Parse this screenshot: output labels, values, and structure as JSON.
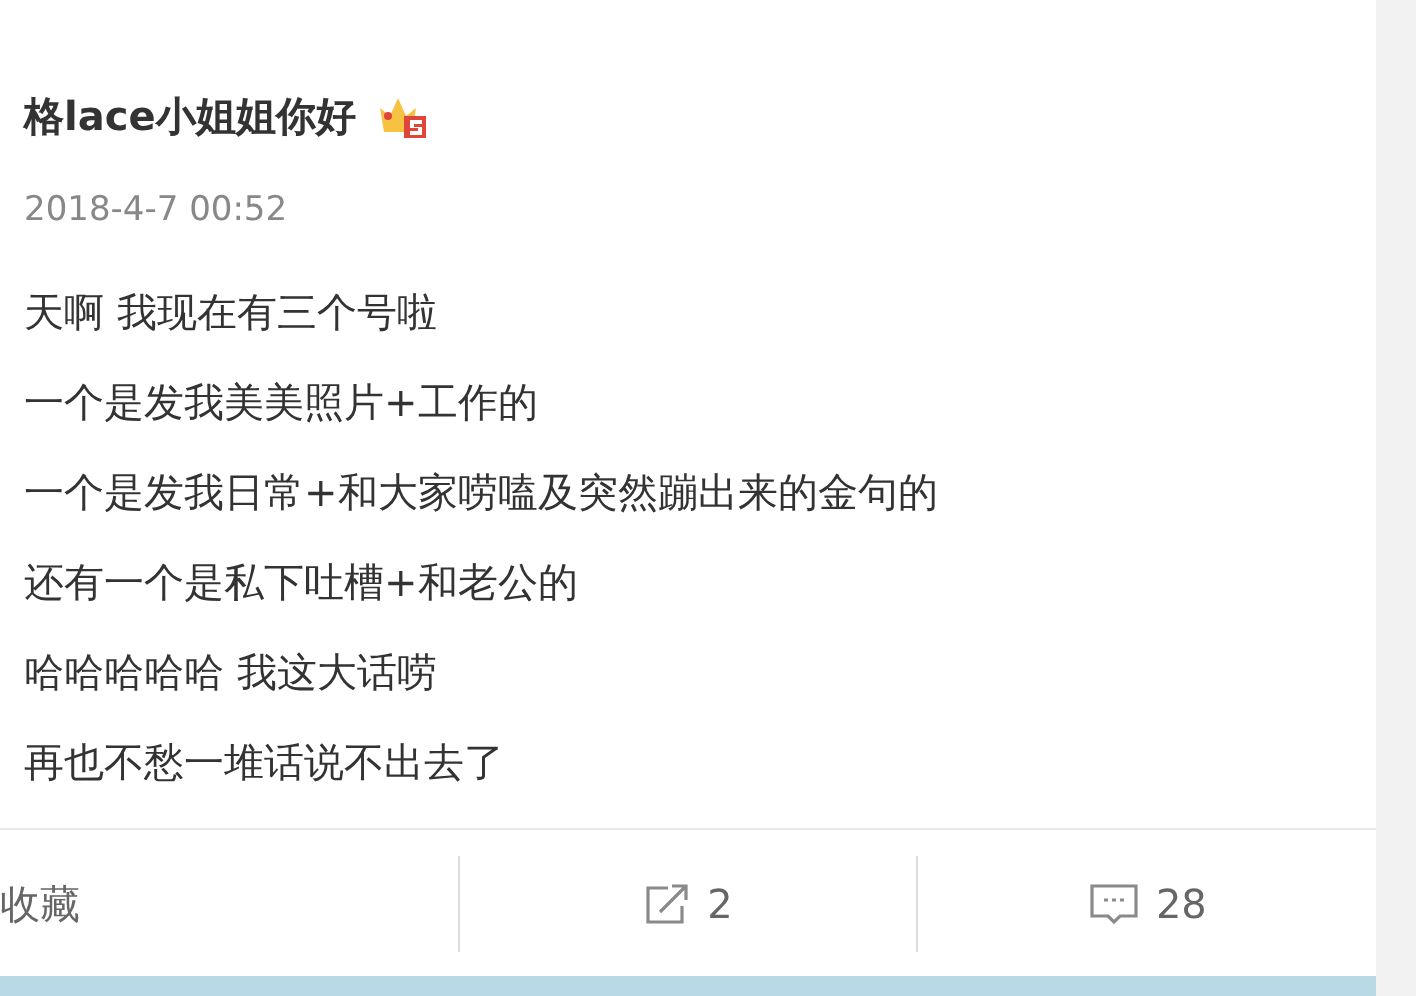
{
  "post": {
    "author": "格lace小姐姐你好",
    "time": "2018-4-7 00:52",
    "lines": [
      "天啊 我现在有三个号啦",
      "一个是发我美美照片+工作的",
      "一个是发我日常+和大家唠嗑及突然蹦出来的金句的",
      "还有一个是私下吐槽+和老公的",
      "哈哈哈哈哈 我这大话唠",
      "再也不愁一堆话说不出去了"
    ]
  },
  "actions": [
    {
      "kind": "favorite",
      "label": "收藏"
    },
    {
      "kind": "repost",
      "label": "2"
    },
    {
      "kind": "comment",
      "label": "28"
    }
  ]
}
